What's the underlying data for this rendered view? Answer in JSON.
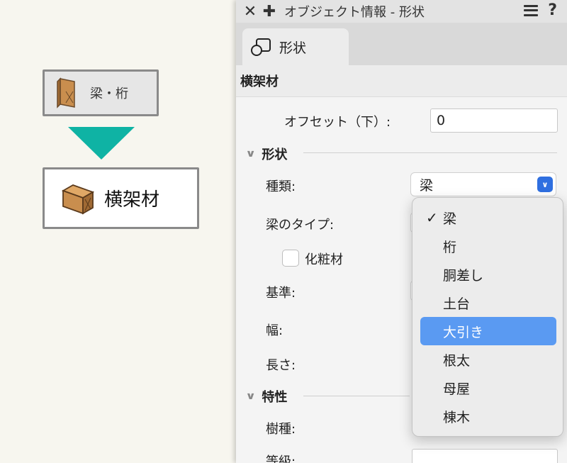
{
  "diagram": {
    "source_label": "梁・桁",
    "target_label": "横架材"
  },
  "panel": {
    "title": "オブジェクト情報 - 形状",
    "tab_label": "形状",
    "section_title": "横架材",
    "offset_label": "オフセット（下）:",
    "offset_value": "0",
    "shape_group": "形状",
    "kind_label": "種類:",
    "kind_value": "梁",
    "beam_type_label": "梁のタイプ:",
    "decorative_label": "化粧材",
    "base_label": "基準:",
    "width_label": "幅:",
    "length_label": "長さ:",
    "props_group": "特性",
    "wood_label": "樹種:",
    "grade_label": "等級:"
  },
  "dropdown": {
    "items": [
      {
        "label": "梁",
        "checked": true
      },
      {
        "label": "桁"
      },
      {
        "label": "胴差し"
      },
      {
        "label": "土台"
      },
      {
        "label": "大引き",
        "highlighted": true
      },
      {
        "label": "根太"
      },
      {
        "label": "母屋"
      },
      {
        "label": "棟木"
      }
    ]
  },
  "colors": {
    "arrow": "#0fb3a4",
    "highlight": "#5a9af2",
    "select_button": "#2f6fe0",
    "wood": "#c98e4e"
  }
}
